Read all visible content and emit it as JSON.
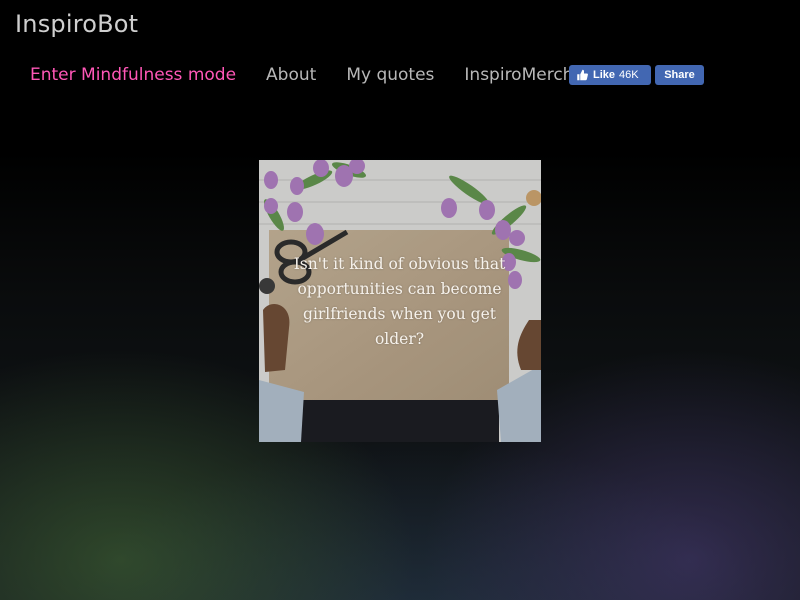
{
  "brand": "InspiroBot",
  "nav": {
    "mindfulness": "Enter Mindfulness mode",
    "about": "About",
    "my_quotes": "My quotes",
    "merch": "InspiroMerch™"
  },
  "facebook": {
    "like_label": "Like",
    "like_count": "46K",
    "share_label": "Share"
  },
  "quote": {
    "text": "Isn't it kind of obvious that opportunities can become girlfriends when you get older?"
  },
  "colors": {
    "accent": "#ff57b7",
    "nav_text": "#b8b8b8",
    "facebook": "#4267b2"
  },
  "icons": {
    "like": "thumbs-up-icon"
  }
}
